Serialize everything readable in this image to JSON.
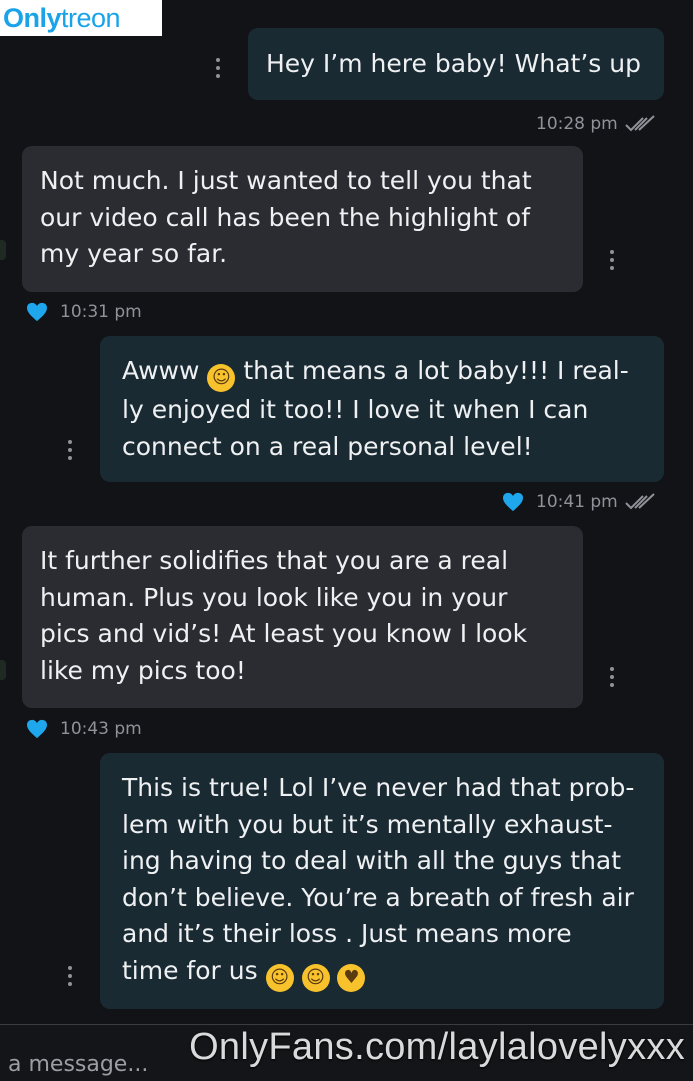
{
  "brand": {
    "part1": "Only",
    "part2": "treon"
  },
  "messages": [
    {
      "text": "Hey I’m here baby! What’s up",
      "time": "10:28 pm"
    },
    {
      "text": "Not much. I just wanted to tell you that our video call has been the highlight of my year so far.",
      "time": "10:31 pm"
    },
    {
      "line1": "Awww",
      "line1b": "that means a lot baby!!! I real-",
      "line2": "ly enjoyed it too!! I love it when I can",
      "line3": "connect on a real personal level!",
      "time": "10:41 pm"
    },
    {
      "text": "It further solidifies that you are a real human. Plus you look like you in your pics and vid’s! At least you know I look like my pics too!",
      "time": "10:43 pm"
    },
    {
      "lines": [
        "This is true! Lol I’ve never had that prob-",
        "lem with you but it’s mentally exhaust-",
        "ing having to deal with all the guys that",
        "don’t believe. You’re a breath of fresh air",
        "and it’s their loss . Just means more"
      ],
      "last": "time for us"
    }
  ],
  "composer": {
    "placeholder": "a message..."
  },
  "watermark": "OnlyFans.com/laylalovelyxxx",
  "colors": {
    "accent": "#1aa3e8",
    "sent_bubble": "#1a2a33",
    "received_bubble": "#2b2c31",
    "heart": "#1ea7ec"
  }
}
